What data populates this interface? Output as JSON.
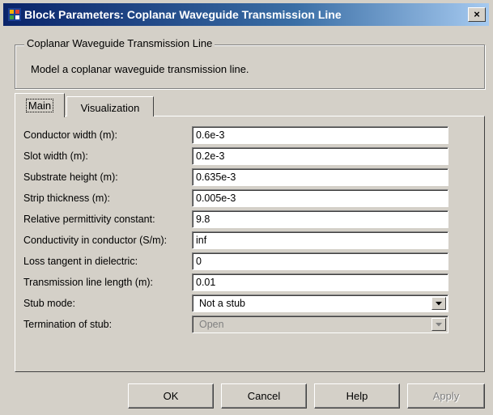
{
  "window": {
    "title": "Block Parameters: Coplanar Waveguide Transmission Line",
    "close_label": "×"
  },
  "group": {
    "title": "Coplanar Waveguide Transmission Line",
    "description": "Model a coplanar waveguide transmission line."
  },
  "tabs": [
    {
      "label": "Main"
    },
    {
      "label": "Visualization"
    }
  ],
  "params": [
    {
      "label": "Conductor width (m):",
      "value": "0.6e-3"
    },
    {
      "label": "Slot width (m):",
      "value": "0.2e-3"
    },
    {
      "label": "Substrate height (m):",
      "value": "0.635e-3"
    },
    {
      "label": "Strip thickness (m):",
      "value": "0.005e-3"
    },
    {
      "label": "Relative permittivity constant:",
      "value": "9.8"
    },
    {
      "label": "Conductivity in conductor (S/m):",
      "value": "inf"
    },
    {
      "label": "Loss tangent in dielectric:",
      "value": "0"
    },
    {
      "label": "Transmission line length (m):",
      "value": "0.01"
    },
    {
      "label": "Stub mode:",
      "value": "Not a stub"
    },
    {
      "label": "Termination of stub:",
      "value": "Open"
    }
  ],
  "buttons": {
    "ok": "OK",
    "cancel": "Cancel",
    "help": "Help",
    "apply": "Apply"
  },
  "icons": {
    "title": "simulink-block-icon",
    "close": "close-icon",
    "dropdown": "chevron-down-icon"
  }
}
